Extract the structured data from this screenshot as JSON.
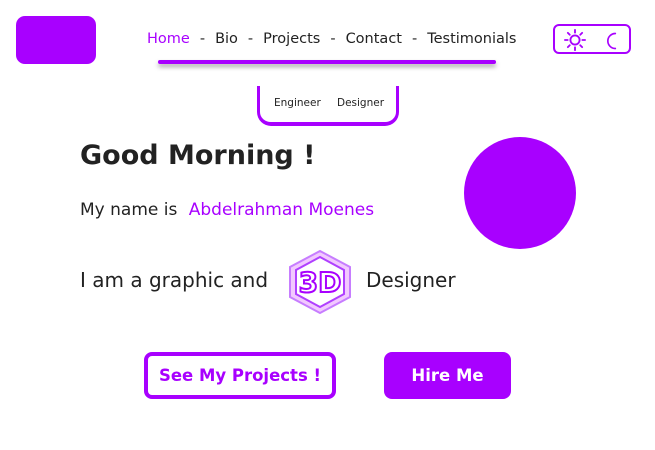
{
  "nav": {
    "items": [
      {
        "label": "Home",
        "active": true
      },
      {
        "label": "Bio"
      },
      {
        "label": "Projects"
      },
      {
        "label": "Contact"
      },
      {
        "label": "Testimonials"
      }
    ],
    "separator": "-"
  },
  "theme_toggle": {
    "icons": [
      "sun-icon",
      "moon-icon"
    ]
  },
  "roles": [
    "Engineer",
    "Designer"
  ],
  "hero": {
    "greeting": "Good Morning !",
    "intro_prefix": "My name is",
    "name": "Abdelrahman Moenes",
    "tagline_prefix": "I am a graphic and",
    "badge_text": "3D",
    "tagline_suffix": "Designer"
  },
  "buttons": {
    "projects": "See My Projects !",
    "hire": "Hire Me"
  },
  "colors": {
    "accent": "#a800ff",
    "text": "#222222",
    "background": "#ffffff"
  }
}
